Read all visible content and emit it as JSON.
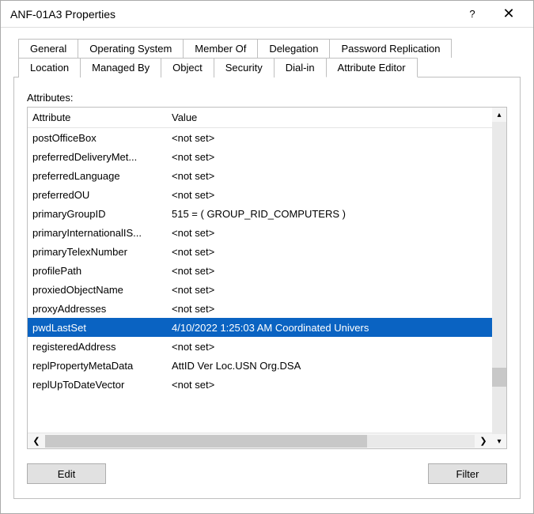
{
  "window": {
    "title": "ANF-01A3 Properties"
  },
  "titlebar_icons": {
    "help": "?",
    "close": "✕"
  },
  "tabs_row1": [
    {
      "label": "General"
    },
    {
      "label": "Operating System"
    },
    {
      "label": "Member Of"
    },
    {
      "label": "Delegation"
    },
    {
      "label": "Password Replication"
    }
  ],
  "tabs_row2": [
    {
      "label": "Location"
    },
    {
      "label": "Managed By"
    },
    {
      "label": "Object"
    },
    {
      "label": "Security"
    },
    {
      "label": "Dial-in"
    },
    {
      "label": "Attribute Editor",
      "active": true
    }
  ],
  "attributes_label": "Attributes:",
  "columns": {
    "attr": "Attribute",
    "val": "Value"
  },
  "rows": [
    {
      "attr": "postOfficeBox",
      "val": "<not set>"
    },
    {
      "attr": "preferredDeliveryMet...",
      "val": "<not set>"
    },
    {
      "attr": "preferredLanguage",
      "val": "<not set>"
    },
    {
      "attr": "preferredOU",
      "val": "<not set>"
    },
    {
      "attr": "primaryGroupID",
      "val": "515 = ( GROUP_RID_COMPUTERS )"
    },
    {
      "attr": "primaryInternationalIS...",
      "val": "<not set>"
    },
    {
      "attr": "primaryTelexNumber",
      "val": "<not set>"
    },
    {
      "attr": "profilePath",
      "val": "<not set>"
    },
    {
      "attr": "proxiedObjectName",
      "val": "<not set>"
    },
    {
      "attr": "proxyAddresses",
      "val": "<not set>"
    },
    {
      "attr": "pwdLastSet",
      "val": "4/10/2022 1:25:03 AM Coordinated Univers",
      "selected": true
    },
    {
      "attr": "registeredAddress",
      "val": "<not set>"
    },
    {
      "attr": "replPropertyMetaData",
      "val": "AttID  Ver      Loc.USN                 Org.DSA"
    },
    {
      "attr": "replUpToDateVector",
      "val": "<not set>"
    }
  ],
  "buttons": {
    "edit": "Edit",
    "filter": "Filter"
  },
  "scroll_chevrons": {
    "left": "❮",
    "right": "❯",
    "up": "▴",
    "down": "▾"
  }
}
